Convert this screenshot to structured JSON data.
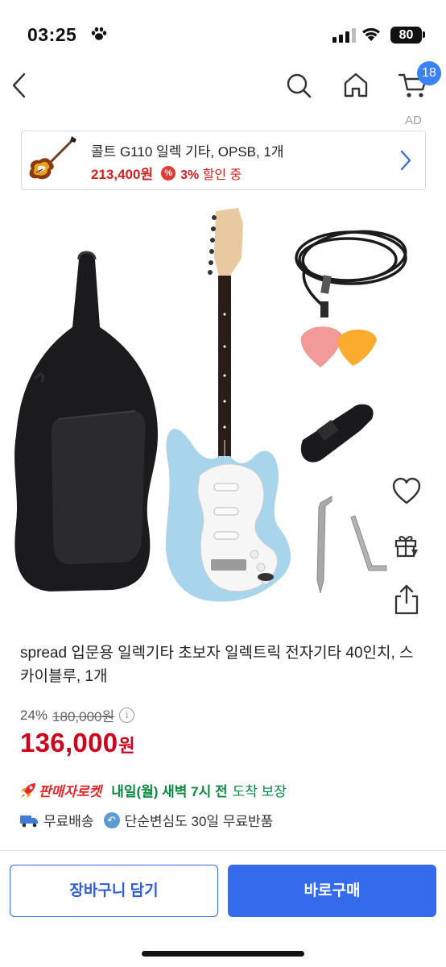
{
  "status_bar": {
    "time": "03:25",
    "battery": "80"
  },
  "nav": {
    "cart_count": "18"
  },
  "ad": {
    "label": "AD",
    "title": "콜트 G110 일렉 기타, OPSB, 1개",
    "price": "213,400원",
    "discount_icon": "%",
    "discount_pct": "3%",
    "discount_text": "할인 중"
  },
  "product": {
    "title": "spread 입문용 일렉기타 초보자 일렉트릭 전자기타 40인치, 스카이블루, 1개",
    "discount_rate": "24%",
    "original_price": "180,000원",
    "sale_price": "136,000",
    "currency": "원",
    "rocket_label": "판매자로켓",
    "delivery_date": "내일(월) 새벽 7시 전",
    "delivery_guarantee": "도착 보장",
    "shipping": "무료배송",
    "return_policy": "단순변심도 30일 무료반품"
  },
  "actions": {
    "add_to_cart": "장바구니 담기",
    "buy_now": "바로구매"
  },
  "colors": {
    "accent": "#346aec",
    "price_red": "#d0021b",
    "delivery_green": "#0a8a3f",
    "badge_blue": "#3b82f6"
  },
  "icons": [
    "paw-icon",
    "back-icon",
    "search-icon",
    "home-icon",
    "cart-icon",
    "chevron-right-icon",
    "heart-icon",
    "gift-icon",
    "share-icon",
    "info-icon",
    "rocket-icon",
    "truck-icon",
    "return-icon"
  ]
}
